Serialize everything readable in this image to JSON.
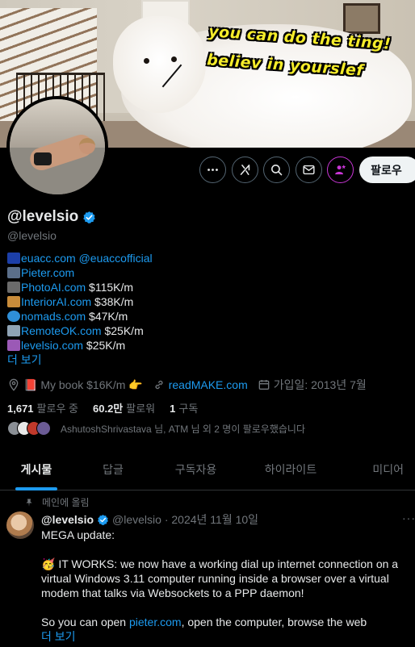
{
  "banner": {
    "meme_line_1": "you can do the ting!",
    "meme_line_2": "believ in yourslef"
  },
  "actions": {
    "more_icon": "more-horizontal-icon",
    "grok_icon": "grok-icon",
    "search_icon": "search-icon",
    "message_icon": "envelope-icon",
    "subscribe_icon": "subscribe-star-person-icon",
    "follow_label": "팔로우"
  },
  "profile": {
    "display_name": "@levelsio",
    "handle": "@levelsio",
    "verified": true
  },
  "bio": {
    "lines": [
      {
        "emoji": "eu-flag",
        "link": "euacc.com",
        "link2": "@euaccofficial",
        "text": ""
      },
      {
        "emoji": "floppy-disk",
        "link": "Pieter.com",
        "text": ""
      },
      {
        "emoji": "camera-flash",
        "link": "PhotoAI.com",
        "text": "$115K/m"
      },
      {
        "emoji": "house",
        "link": "InteriorAI.com",
        "text": "$38K/m"
      },
      {
        "emoji": "globe",
        "link": "nomads.com",
        "text": "$47K/m"
      },
      {
        "emoji": "satellite",
        "link": "RemoteOK.com",
        "text": "$25K/m"
      },
      {
        "emoji": "alembic",
        "link": "levelsio.com",
        "text": "$25K/m"
      }
    ],
    "more_label": "더 보기"
  },
  "meta": {
    "location": "📕 My book $16K/m 👉",
    "website": "readMAKE.com",
    "joined": "가입일: 2013년 7월"
  },
  "stats": {
    "following_count": "1,671",
    "following_label": "팔로우 중",
    "followers_count": "60.2만",
    "followers_label": "팔로워",
    "subs_count": "1",
    "subs_label": "구독"
  },
  "followed_by": "AshutoshShrivastava 님, ATM 님 외 2 명이 팔로우했습니다",
  "tabs": [
    {
      "label": "게시물",
      "active": true
    },
    {
      "label": "답글",
      "active": false
    },
    {
      "label": "구독자용",
      "active": false
    },
    {
      "label": "하이라이트",
      "active": false
    },
    {
      "label": "미디어",
      "active": false
    }
  ],
  "post": {
    "pinned_label": "메인에 올림",
    "name": "@levelsio",
    "handle_date": "@levelsio · 2024년 11월 10일",
    "menu": "···",
    "line1": "MEGA update:",
    "line2": "🥳 IT WORKS: we now have a working dial up internet connection on a",
    "line3": "virtual Windows 3.11 computer running inside a browser over a virtual",
    "line4": "modem that talks via Websockets to a PPP daemon!",
    "line5_pre": "So you can open ",
    "line5_link": "pieter.com",
    "line5_post": ", open the computer,  browse the web",
    "more_label": "더 보기"
  },
  "colors": {
    "accent": "#1d9bf0",
    "background": "#000000",
    "text": "#e7e9ea",
    "muted": "#71767b",
    "meme_text": "#f5ec2a",
    "subscribe_ring": "#c936d6"
  }
}
